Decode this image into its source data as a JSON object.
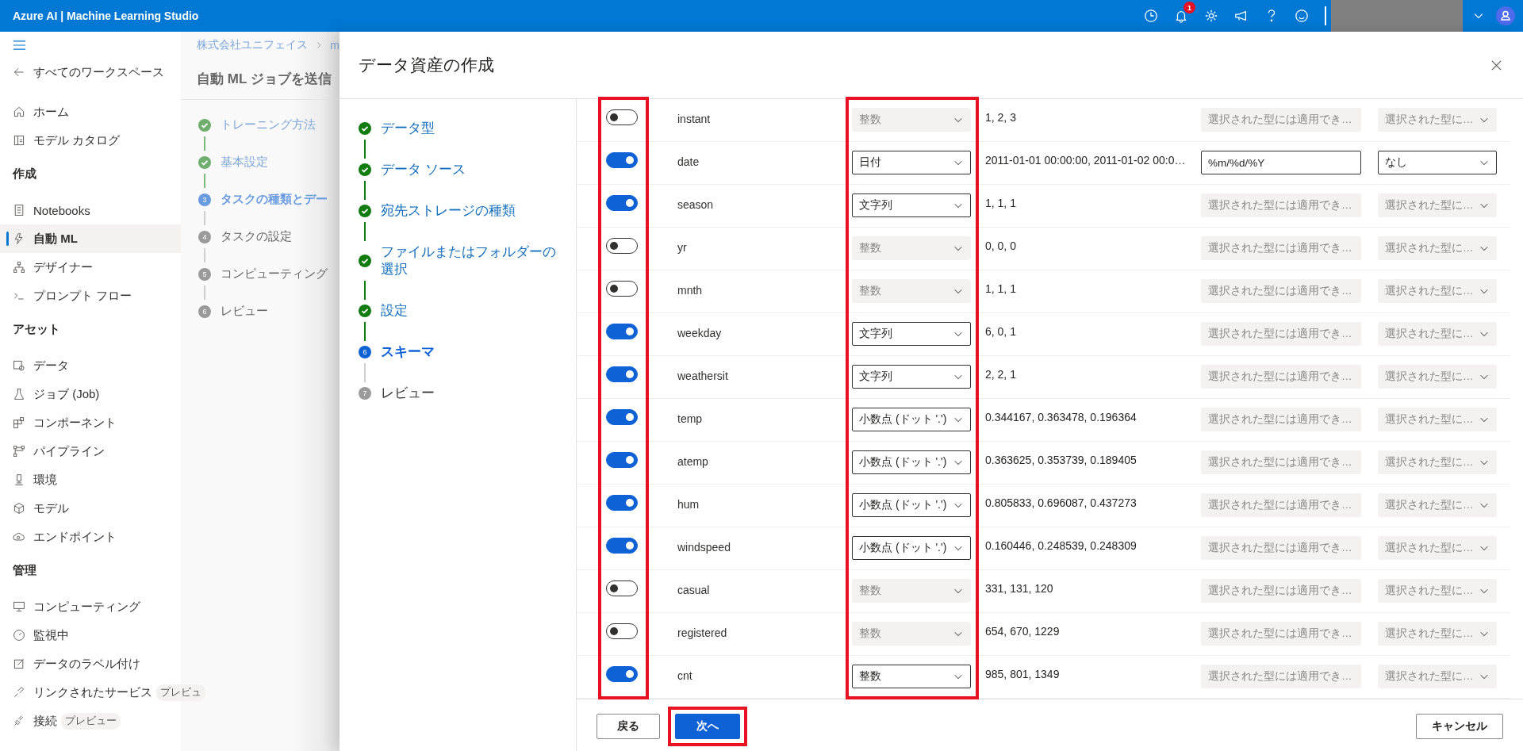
{
  "topbar": {
    "title": "Azure AI | Machine Learning Studio",
    "notification_count": "1"
  },
  "sidebar": {
    "back": "すべてのワークスペース",
    "items": [
      {
        "kind": "item",
        "label": "ホーム",
        "selected": false
      },
      {
        "kind": "item",
        "label": "モデル カタログ",
        "selected": false
      },
      {
        "kind": "section",
        "label": "作成"
      },
      {
        "kind": "item",
        "label": "Notebooks",
        "selected": false
      },
      {
        "kind": "item",
        "label": "自動 ML",
        "selected": true
      },
      {
        "kind": "item",
        "label": "デザイナー",
        "selected": false
      },
      {
        "kind": "item",
        "label": "プロンプト フロー",
        "selected": false
      },
      {
        "kind": "section",
        "label": "アセット"
      },
      {
        "kind": "item",
        "label": "データ",
        "selected": false
      },
      {
        "kind": "item",
        "label": "ジョブ (Job)",
        "selected": false
      },
      {
        "kind": "item",
        "label": "コンポーネント",
        "selected": false
      },
      {
        "kind": "item",
        "label": "パイプライン",
        "selected": false
      },
      {
        "kind": "item",
        "label": "環境",
        "selected": false
      },
      {
        "kind": "item",
        "label": "モデル",
        "selected": false
      },
      {
        "kind": "item",
        "label": "エンドポイント",
        "selected": false
      },
      {
        "kind": "section",
        "label": "管理"
      },
      {
        "kind": "item",
        "label": "コンピューティング",
        "selected": false
      },
      {
        "kind": "item",
        "label": "監視中",
        "selected": false
      },
      {
        "kind": "item",
        "label": "データのラベル付け",
        "selected": false
      },
      {
        "kind": "item",
        "label": "リンクされたサービス",
        "selected": false,
        "badge": "プレビュ"
      },
      {
        "kind": "item",
        "label": "接続",
        "selected": false,
        "badge": "プレビュー"
      }
    ]
  },
  "background_page": {
    "breadcrumb": [
      "株式会社ユニフェイス",
      "m"
    ],
    "title": "自動 ML ジョブを送信",
    "steps": [
      {
        "label": "トレーニング方法",
        "completed": true,
        "current": false
      },
      {
        "label": "基本設定",
        "completed": true,
        "current": false
      },
      {
        "label": "タスクの種類とデー",
        "completed": false,
        "current": true,
        "number": "3"
      },
      {
        "label": "タスクの設定",
        "completed": false,
        "current": false,
        "number": "4"
      },
      {
        "label": "コンピューティング",
        "completed": false,
        "current": false,
        "number": "5"
      },
      {
        "label": "レビュー",
        "completed": false,
        "current": false,
        "number": "6"
      }
    ]
  },
  "dialog": {
    "title": "データ資産の作成",
    "steps": [
      {
        "label": "データ型",
        "completed": true,
        "current": false
      },
      {
        "label": "データ ソース",
        "completed": true,
        "current": false
      },
      {
        "label": "宛先ストレージの種類",
        "completed": true,
        "current": false
      },
      {
        "label": "ファイルまたはフォルダーの選択",
        "completed": true,
        "current": false
      },
      {
        "label": "設定",
        "completed": true,
        "current": false
      },
      {
        "label": "スキーマ",
        "completed": false,
        "current": true,
        "number": "6"
      },
      {
        "label": "レビュー",
        "completed": false,
        "current": false,
        "number": "7"
      }
    ],
    "rows": [
      {
        "enabled": false,
        "name": "instant",
        "type": "整数",
        "sample": "1, 2, 3",
        "format_enabled": false,
        "format": "選択された型には適用でき…",
        "option": "選択された型に…"
      },
      {
        "enabled": true,
        "name": "date",
        "type": "日付",
        "sample": "2011-01-01 00:00:00, 2011-01-02 00:0…",
        "format_enabled": true,
        "format": "%m/%d/%Y",
        "option": "なし"
      },
      {
        "enabled": true,
        "name": "season",
        "type": "文字列",
        "sample": "1, 1, 1",
        "format_enabled": false,
        "format": "選択された型には適用でき…",
        "option": "選択された型に…"
      },
      {
        "enabled": false,
        "name": "yr",
        "type": "整数",
        "sample": "0, 0, 0",
        "format_enabled": false,
        "format": "選択された型には適用でき…",
        "option": "選択された型に…"
      },
      {
        "enabled": false,
        "name": "mnth",
        "type": "整数",
        "sample": "1, 1, 1",
        "format_enabled": false,
        "format": "選択された型には適用でき…",
        "option": "選択された型に…"
      },
      {
        "enabled": true,
        "name": "weekday",
        "type": "文字列",
        "sample": "6, 0, 1",
        "format_enabled": false,
        "format": "選択された型には適用でき…",
        "option": "選択された型に…"
      },
      {
        "enabled": true,
        "name": "weathersit",
        "type": "文字列",
        "sample": "2, 2, 1",
        "format_enabled": false,
        "format": "選択された型には適用でき…",
        "option": "選択された型に…"
      },
      {
        "enabled": true,
        "name": "temp",
        "type": "小数点 (ドット '.')",
        "sample": "0.344167, 0.363478, 0.196364",
        "format_enabled": false,
        "format": "選択された型には適用でき…",
        "option": "選択された型に…"
      },
      {
        "enabled": true,
        "name": "atemp",
        "type": "小数点 (ドット '.')",
        "sample": "0.363625, 0.353739, 0.189405",
        "format_enabled": false,
        "format": "選択された型には適用でき…",
        "option": "選択された型に…"
      },
      {
        "enabled": true,
        "name": "hum",
        "type": "小数点 (ドット '.')",
        "sample": "0.805833, 0.696087, 0.437273",
        "format_enabled": false,
        "format": "選択された型には適用でき…",
        "option": "選択された型に…"
      },
      {
        "enabled": true,
        "name": "windspeed",
        "type": "小数点 (ドット '.')",
        "sample": "0.160446, 0.248539, 0.248309",
        "format_enabled": false,
        "format": "選択された型には適用でき…",
        "option": "選択された型に…"
      },
      {
        "enabled": false,
        "name": "casual",
        "type": "整数",
        "sample": "331, 131, 120",
        "format_enabled": false,
        "format": "選択された型には適用でき…",
        "option": "選択された型に…"
      },
      {
        "enabled": false,
        "name": "registered",
        "type": "整数",
        "sample": "654, 670, 1229",
        "format_enabled": false,
        "format": "選択された型には適用でき…",
        "option": "選択された型に…"
      },
      {
        "enabled": true,
        "name": "cnt",
        "type": "整数",
        "sample": "985, 801, 1349",
        "format_enabled": false,
        "format": "選択された型には適用でき…",
        "option": "選択された型に…"
      }
    ],
    "buttons": {
      "back": "戻る",
      "next": "次へ",
      "cancel": "キャンセル"
    },
    "highlights": {
      "toggle_column": true,
      "type_column": true,
      "next_button": true
    }
  }
}
